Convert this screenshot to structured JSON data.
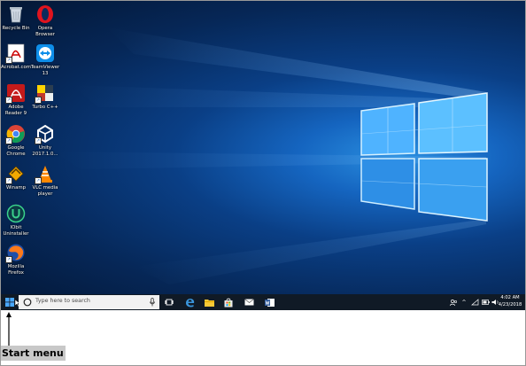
{
  "desktop_icons": [
    {
      "name": "recycle-bin-icon",
      "label": "Recycle Bin"
    },
    {
      "name": "opera-icon",
      "label": "Opera Browser"
    },
    {
      "name": "acrobat-icon",
      "label": "Acrobat.com"
    },
    {
      "name": "teamviewer-icon",
      "label": "TeamViewer 13"
    },
    {
      "name": "adobe-reader-icon",
      "label": "Adobe Reader 9"
    },
    {
      "name": "turbo-cpp-icon",
      "label": "Turbo C++"
    },
    {
      "name": "chrome-icon",
      "label": "Google Chrome"
    },
    {
      "name": "unity-icon",
      "label": "Unity 2017.1.0..."
    },
    {
      "name": "winamp-icon",
      "label": "Winamp"
    },
    {
      "name": "vlc-icon",
      "label": "VLC media player"
    },
    {
      "name": "iobit-icon",
      "label": "IObit Uninstaller"
    },
    {
      "name": "firefox-icon",
      "label": "Mozilla Firefox"
    }
  ],
  "taskbar": {
    "search_placeholder": "Type here to search",
    "apps": [
      "task-view-icon",
      "edge-icon",
      "file-explorer-icon",
      "store-icon",
      "mail-icon",
      "word-icon"
    ],
    "clock_time": "4:02 AM",
    "clock_date": "4/23/2018"
  },
  "caption": {
    "text": "Start menu"
  },
  "colors": {
    "taskbar": "#101a26",
    "accent": "#1e88e5"
  }
}
